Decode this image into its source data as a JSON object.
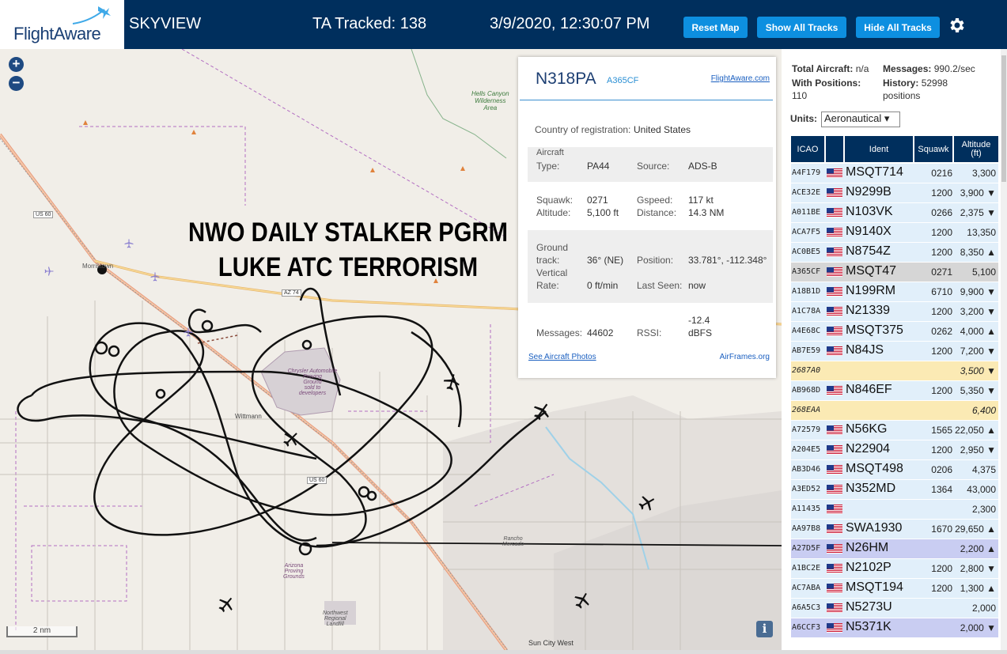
{
  "header": {
    "logo": "FlightAware",
    "title": "SKYVIEW",
    "tracked": "TA Tracked: 138",
    "datetime": "3/9/2020, 12:30:07 PM",
    "reset_map": "Reset Map",
    "show_tracks": "Show All Tracks",
    "hide_tracks": "Hide All Tracks"
  },
  "map": {
    "zoom_in": "+",
    "zoom_out": "−",
    "overlay_line1": "NWO DAILY STALKER PGRM",
    "overlay_line2": "LUKE ATC TERRORISM",
    "scale": "2 nm",
    "info": "i",
    "labels": {
      "hells_canyon": "Hells Canyon",
      "wilderness": "Wilderness",
      "area": "Area",
      "morristown": "Morristown",
      "us60a": "US 60",
      "us60b": "US 60",
      "az74": "AZ 74",
      "wittmann": "Wittmann",
      "chrysler1": "Chrysler Automobile",
      "chrysler2": "Proving",
      "chrysler3": "Ground",
      "chrysler4": "sold to",
      "chrysler5": "developers",
      "rancho1": "Rancho",
      "rancho2": "Mercado",
      "arizona1": "Arizona",
      "arizona2": "Proving",
      "arizona3": "Grounds",
      "northwest1": "Northwest",
      "northwest2": "Regional",
      "northwest3": "Landfill",
      "suncity": "Sun City West"
    }
  },
  "popup": {
    "callsign": "N318PA",
    "icao": "A365CF",
    "link": "FlightAware.com",
    "country_label": "Country of registration:",
    "country": "United States",
    "aircraft_label": "Aircraft",
    "type_label": "Type:",
    "type": "PA44",
    "source_label": "Source:",
    "source": "ADS-B",
    "squawk_label": "Squawk:",
    "squawk": "0271",
    "altitude_label": "Altitude:",
    "altitude": "5,100 ft",
    "gspeed_label": "Gspeed:",
    "gspeed": "117 kt",
    "distance_label": "Distance:",
    "distance": "14.3 NM",
    "ground_label": "Ground",
    "track_label": "track:",
    "track": "36° (NE)",
    "position_label": "Position:",
    "position": "33.781°, -112.348°",
    "vertical_label": "Vertical",
    "rate_label": "Rate:",
    "rate": "0 ft/min",
    "lastseen_label": "Last Seen:",
    "lastseen": "now",
    "messages_label": "Messages:",
    "messages": "44602",
    "rssi_label": "RSSI:",
    "rssi_val": "-12.4",
    "rssi_unit": "dBFS",
    "photos": "See Aircraft Photos",
    "airframes": "AirFrames.org"
  },
  "sidebar": {
    "total_label": "Total Aircraft:",
    "total": "n/a",
    "messages_label": "Messages:",
    "messages": "990.2/sec",
    "withpos_label": "With Positions:",
    "withpos": "110",
    "history_label": "History:",
    "history": "52998",
    "history_unit": "positions",
    "units_label": "Units:",
    "units_value": "Aeronautical ▾",
    "columns": {
      "icao": "ICAO",
      "ident": "Ident",
      "squawk": "Squawk",
      "alt1": "Altitude",
      "alt2": "(ft)"
    },
    "rows": [
      {
        "icao": "A4F179",
        "ident": "MSQT714",
        "squawk": "0216",
        "alt": "3,300",
        "bg": "#e1effa",
        "flag": true
      },
      {
        "icao": "ACE32E",
        "ident": "N9299B",
        "squawk": "1200",
        "alt": "3,900 ▼",
        "bg": "#e1effa",
        "flag": true
      },
      {
        "icao": "A011BE",
        "ident": "N103VK",
        "squawk": "0266",
        "alt": "2,375 ▼",
        "bg": "#e1effa",
        "flag": true
      },
      {
        "icao": "ACA7F5",
        "ident": "N9140X",
        "squawk": "1200",
        "alt": "13,350",
        "bg": "#e1effa",
        "flag": true
      },
      {
        "icao": "AC0BE5",
        "ident": "N8754Z",
        "squawk": "1200",
        "alt": "8,350 ▲",
        "bg": "#e1effa",
        "flag": true
      },
      {
        "icao": "A365CF",
        "ident": "MSQT47",
        "squawk": "0271",
        "alt": "5,100",
        "bg": "#d6d6d6",
        "flag": true
      },
      {
        "icao": "A18B1D",
        "ident": "N199RM",
        "squawk": "6710",
        "alt": "9,900 ▼",
        "bg": "#e1effa",
        "flag": true
      },
      {
        "icao": "A1C78A",
        "ident": "N21339",
        "squawk": "1200",
        "alt": "3,200 ▼",
        "bg": "#e1effa",
        "flag": true
      },
      {
        "icao": "A4E68C",
        "ident": "MSQT375",
        "squawk": "0262",
        "alt": "4,000 ▲",
        "bg": "#e1effa",
        "flag": true
      },
      {
        "icao": "AB7E59",
        "ident": "N84JS",
        "squawk": "1200",
        "alt": "7,200 ▼",
        "bg": "#e1effa",
        "flag": true
      },
      {
        "icao": "2687A0",
        "ident": "",
        "squawk": "",
        "alt": "3,500 ▼",
        "bg": "#fbeab4",
        "flag": false,
        "italic": true
      },
      {
        "icao": "AB968D",
        "ident": "N846EF",
        "squawk": "1200",
        "alt": "5,350 ▼",
        "bg": "#e1effa",
        "flag": true
      },
      {
        "icao": "268EAA",
        "ident": "",
        "squawk": "",
        "alt": "6,400",
        "bg": "#fbeab4",
        "flag": false,
        "italic": true
      },
      {
        "icao": "A72579",
        "ident": "N56KG",
        "squawk": "1565",
        "alt": "22,050 ▲",
        "bg": "#e1effa",
        "flag": true
      },
      {
        "icao": "A204E5",
        "ident": "N22904",
        "squawk": "1200",
        "alt": "2,950 ▼",
        "bg": "#e1effa",
        "flag": true
      },
      {
        "icao": "AB3D46",
        "ident": "MSQT498",
        "squawk": "0206",
        "alt": "4,375",
        "bg": "#e1effa",
        "flag": true
      },
      {
        "icao": "A3ED52",
        "ident": "N352MD",
        "squawk": "1364",
        "alt": "43,000",
        "bg": "#e1effa",
        "flag": true
      },
      {
        "icao": "A11435",
        "ident": "",
        "squawk": "",
        "alt": "2,300",
        "bg": "#e1effa",
        "flag": true
      },
      {
        "icao": "AA97B8",
        "ident": "SWA1930",
        "squawk": "1670",
        "alt": "29,650 ▲",
        "bg": "#e1effa",
        "flag": true
      },
      {
        "icao": "A27D5F",
        "ident": "N26HM",
        "squawk": "",
        "alt": "2,200 ▲",
        "bg": "#c9cdf2",
        "flag": true
      },
      {
        "icao": "A1BC2E",
        "ident": "N2102P",
        "squawk": "1200",
        "alt": "2,800 ▼",
        "bg": "#e1effa",
        "flag": true
      },
      {
        "icao": "AC7ABA",
        "ident": "MSQT194",
        "squawk": "1200",
        "alt": "1,300 ▲",
        "bg": "#e1effa",
        "flag": true
      },
      {
        "icao": "A6A5C3",
        "ident": "N5273U",
        "squawk": "",
        "alt": "2,000",
        "bg": "#e1effa",
        "flag": true
      },
      {
        "icao": "A6CCF3",
        "ident": "N5371K",
        "squawk": "",
        "alt": "2,000 ▼",
        "bg": "#c9cdf2",
        "flag": true
      }
    ]
  }
}
